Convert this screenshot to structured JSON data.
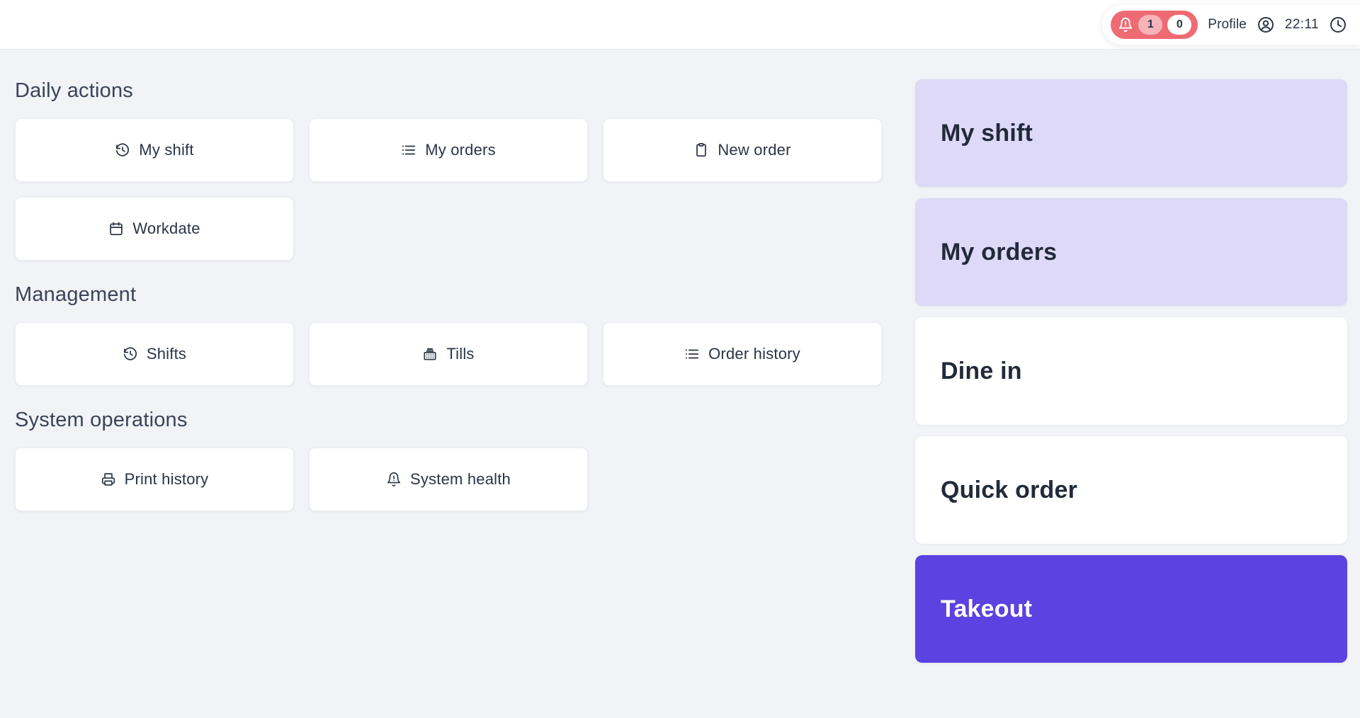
{
  "topbar": {
    "notification": {
      "icon": "bell-alert-icon",
      "warn_count": "1",
      "ok_count": "0"
    },
    "profile_label": "Profile",
    "profile_icon": "user-circle-icon",
    "time": "22:11",
    "clock_icon": "clock-icon"
  },
  "sections": [
    {
      "key": "daily",
      "title": "Daily actions",
      "buttons": [
        {
          "label": "My shift",
          "icon": "clock-history-icon"
        },
        {
          "label": "My orders",
          "icon": "list-bullet-icon"
        },
        {
          "label": "New order",
          "icon": "clipboard-icon"
        },
        {
          "label": "Workdate",
          "icon": "calendar-icon"
        }
      ]
    },
    {
      "key": "management",
      "title": "Management",
      "buttons": [
        {
          "label": "Shifts",
          "icon": "clock-history-icon"
        },
        {
          "label": "Tills",
          "icon": "cash-register-icon"
        },
        {
          "label": "Order history",
          "icon": "list-bullet-icon"
        }
      ]
    },
    {
      "key": "system",
      "title": "System operations",
      "buttons": [
        {
          "label": "Print history",
          "icon": "printer-icon"
        },
        {
          "label": "System health",
          "icon": "bell-alert-icon"
        }
      ]
    }
  ],
  "nav_cards": [
    {
      "label": "My shift",
      "style": "lavender"
    },
    {
      "label": "My orders",
      "style": "lavender"
    },
    {
      "label": "Dine in",
      "style": "white"
    },
    {
      "label": "Quick order",
      "style": "white"
    },
    {
      "label": "Takeout",
      "style": "primary"
    }
  ],
  "colors": {
    "page_background": "#f1f3f6",
    "card_surface": "#ffffff",
    "accent_primary": "#5c42e0",
    "accent_lavender": "#ddd9f6",
    "notification_red": "#ef6b74",
    "notification_warn_pill": "#f6b3b8",
    "text_primary": "#2b3445",
    "heading": "#3a4458"
  }
}
